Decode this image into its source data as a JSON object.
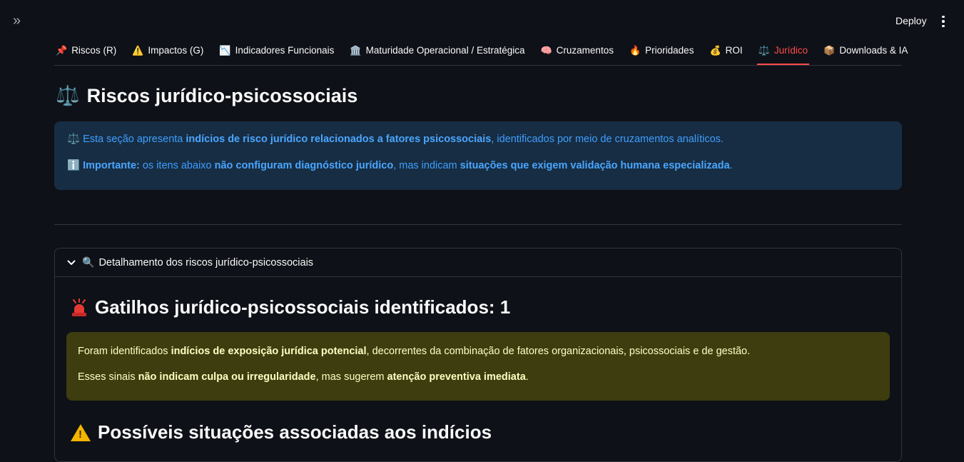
{
  "topbar": {
    "sidebar_toggle": "»",
    "deploy_label": "Deploy"
  },
  "tabs": [
    {
      "icon": "📌",
      "label": "Riscos (R)",
      "active": false
    },
    {
      "icon": "⚠️",
      "label": "Impactos (G)",
      "active": false
    },
    {
      "icon": "📉",
      "label": "Indicadores Funcionais",
      "active": false
    },
    {
      "icon": "🏛️",
      "label": "Maturidade Operacional / Estratégica",
      "active": false
    },
    {
      "icon": "🧠",
      "label": "Cruzamentos",
      "active": false
    },
    {
      "icon": "🔥",
      "label": "Prioridades",
      "active": false
    },
    {
      "icon": "💰",
      "label": "ROI",
      "active": false
    },
    {
      "icon": "⚖️",
      "label": "Jurídico",
      "active": true
    },
    {
      "icon": "📦",
      "label": "Downloads & IA",
      "active": false
    }
  ],
  "page": {
    "title_icon": "⚖️",
    "title": "Riscos jurídico-psicossociais"
  },
  "info_box": {
    "line1": {
      "icon": "⚖️",
      "pre": " Esta seção apresenta ",
      "bold": "indícios de risco jurídico relacionados a fatores psicossociais",
      "post": ", identificados por meio de cruzamentos analíticos."
    },
    "line2": {
      "icon": "ℹ️",
      "bold1": " Importante:",
      "mid1": " os itens abaixo ",
      "bold2": "não configuram diagnóstico jurídico",
      "mid2": ", mas indicam ",
      "bold3": "situações que exigem validação humana especializada",
      "post": "."
    }
  },
  "expander": {
    "icon": "🔍",
    "label": "Detalhamento dos riscos jurídico-psicossociais",
    "expanded": true
  },
  "triggers": {
    "title": "Gatilhos jurídico-psicossociais identificados: 1",
    "count": 1
  },
  "warn_box": {
    "line1": {
      "pre": "Foram identificados ",
      "bold": "indícios de exposição jurídica potencial",
      "post": ", decorrentes da combinação de fatores organizacionais, psicossociais e de gestão."
    },
    "line2": {
      "pre": "Esses sinais ",
      "bold1": "não indicam culpa ou irregularidade",
      "mid": ", mas sugerem ",
      "bold2": "atenção preventiva imediata",
      "post": "."
    }
  },
  "situations": {
    "title": "Possíveis situações associadas aos indícios"
  },
  "colors": {
    "background": "#0e1117",
    "active_tab": "#ff4b4b",
    "info_bg": "#172d43",
    "info_text": "#3e9eff",
    "warn_bg": "#3d3d0f",
    "warn_text": "#ffffc2"
  }
}
